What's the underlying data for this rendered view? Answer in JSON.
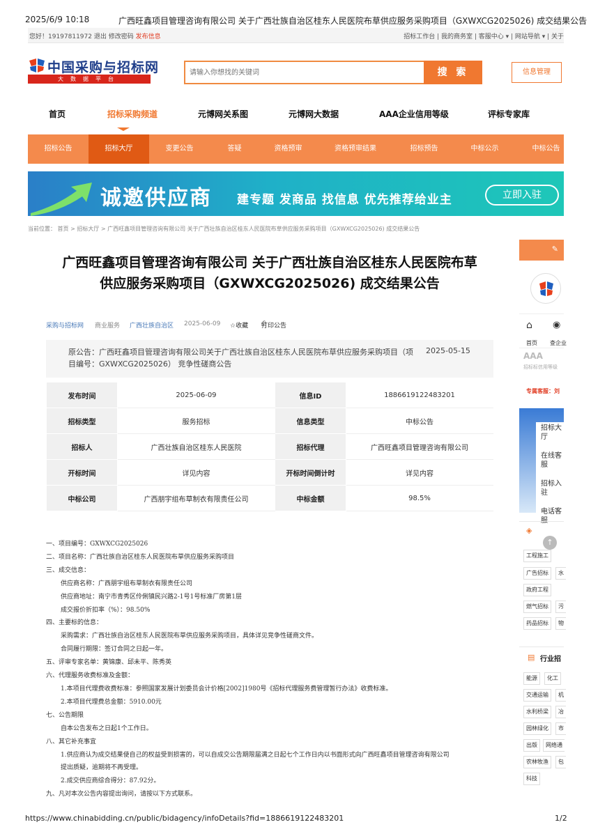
{
  "print_header": {
    "datetime": "2025/6/9 10:18",
    "doc_title": "广西旺鑫项目管理咨询有限公司 关于广西壮族自治区桂东人民医院布草供应服务采购项目（GXWXCG2025026) 成交结果公告"
  },
  "topbar": {
    "greeting": "您好！19197811972 退出 修改密码",
    "publish": "发布信息",
    "right_links": "招标工作台 | 我的商务室 | 客服中心 ▾ | 网站导航 ▾ | 关于"
  },
  "logo": {
    "name": "中国采购与招标网",
    "tagline": "大数据平台"
  },
  "search": {
    "placeholder": "请输入你想找的关键词",
    "button": "搜 索"
  },
  "info_manage": "信息管理",
  "main_nav": [
    "首页",
    "招标采购频道",
    "元博网关系图",
    "元博网大数据",
    "AAA企业信用等级",
    "评标专家库"
  ],
  "sub_nav": [
    "招标公告",
    "招标大厅",
    "变更公告",
    "答疑",
    "资格预审",
    "资格预审结果",
    "招标预告",
    "中标公示",
    "中标公告"
  ],
  "banner": {
    "headline": "诚邀供应商",
    "subline": "建专题 发商品 找信息 优先推荐给业主",
    "cta": "立即入驻"
  },
  "breadcrumb": "当前位置： 首页 > 招标大厅 > 广西旺鑫项目管理咨询有限公司 关于广西壮族自治区桂东人民医院布草供应服务采购项目（GXWXCG2025026) 成交结果公告",
  "title_line1": "广西旺鑫项目管理咨询有限公司 关于广西壮族自治区桂东人民医院布草",
  "title_line2": "供应服务采购项目（GXWXCG2025026) 成交结果公告",
  "meta": {
    "category": "采购与招标网",
    "type": "商业服务",
    "region": "广西壮族自治区",
    "date": "2025-06-09",
    "favorite": "☆收藏",
    "print": "打印公告"
  },
  "original": {
    "text": "原公告：广西旺鑫项目管理咨询有限公司关于广西壮族自治区桂东人民医院布草供应服务采购项目（项目编号：GXWXCG2025026） 竞争性磋商公告",
    "date": "2025-05-15"
  },
  "info_table": [
    {
      "k1": "发布时间",
      "v1": "2025-06-09",
      "k2": "信息ID",
      "v2": "1886619122483201"
    },
    {
      "k1": "招标类型",
      "v1": "服务招标",
      "k2": "信息类型",
      "v2": "中标公告"
    },
    {
      "k1": "招标人",
      "v1": "广西壮族自治区桂东人民医院",
      "k2": "招标代理",
      "v2": "广西旺鑫项目管理咨询有限公司"
    },
    {
      "k1": "开标时间",
      "v1": "详见内容",
      "k2": "开标时间倒计时",
      "v2": "详见内容"
    },
    {
      "k1": "中标公司",
      "v1": "广西朋宇组布草制衣有限责任公司",
      "k2": "中标金额",
      "v2": "98.5%"
    }
  ],
  "content_lines": [
    {
      "text": "一、项目编号：GXWXCG2025026",
      "indent": false
    },
    {
      "text": "二、项目名称：广西壮族自治区桂东人民医院布草供应服务采购项目",
      "indent": false
    },
    {
      "text": "三、成交信息：",
      "indent": false
    },
    {
      "text": "供应商名称：广西朋宇组布草制衣有限责任公司",
      "indent": true
    },
    {
      "text": "供应商地址：南宁市青秀区伶俐镇民兴路2-1号1号标准厂房第1层",
      "indent": true
    },
    {
      "text": "成交报价折扣率（%）：98.50%",
      "indent": true
    },
    {
      "text": "四、主要标的信息：",
      "indent": false
    },
    {
      "text": "采购需求：广西壮族自治区桂东人民医院布草供应服务采购项目，具体详见竞争性磋商文件。",
      "indent": true
    },
    {
      "text": "合同履行期限：签订合同之日起一年。",
      "indent": true
    },
    {
      "text": "五、评审专家名单：黄锦康、邱未平、陈秀英",
      "indent": false
    },
    {
      "text": "六、代理服务收费标准及金额：",
      "indent": false
    },
    {
      "text": "1.本项目代理费收费标准：参照国家发展计划委员会计价格[2002]1980号《招标代理服务费管理暂行办法》收费标准。",
      "indent": true
    },
    {
      "text": "2.本项目代理费总金额：5910.00元",
      "indent": true
    },
    {
      "text": "七、公告期限",
      "indent": false
    },
    {
      "text": "自本公告发布之日起1个工作日。",
      "indent": true
    },
    {
      "text": "八、其它补充事宜",
      "indent": false
    },
    {
      "text": "1.供应商认为成交结果使自己的权益受到损害的，可以自成交公告期限届满之日起七个工作日内以书面形式向广西旺鑫项目管理咨询有限公司",
      "indent": true
    },
    {
      "text": "提出质疑，逾期将不再受理。",
      "indent": true
    },
    {
      "text": "2.成交供应商综合得分：87.92分。",
      "indent": true
    },
    {
      "text": "九、凡对本次公告内容提出询问，请按以下方式联系。",
      "indent": false
    }
  ],
  "sidebar": {
    "home": "首页",
    "check": "查企业",
    "aaa": "AAA",
    "aaa_sub": "招标标信用等级",
    "kefu": "专属客服：刘",
    "float": [
      "招标大厅",
      "在线客服",
      "招标入驻",
      "电话客服"
    ],
    "tags1": [
      "工程施工",
      "广告招标",
      "政府工程",
      "燃气招标",
      "药品招标"
    ],
    "tags1b": [
      "水",
      "污",
      "物"
    ],
    "industry_title": "行业招",
    "tags2": [
      "能源",
      "化工",
      "交通运输",
      "水利桥梁",
      "园林绿化",
      "出版",
      "网络通",
      "农林牧渔",
      "科技"
    ],
    "tags2b": [
      "机",
      "冶",
      "市",
      "包"
    ]
  },
  "print_footer": {
    "url": "https://www.chinabidding.cn/public/bidagency/infoDetails?fid=1886619122483201",
    "page": "1/2"
  }
}
